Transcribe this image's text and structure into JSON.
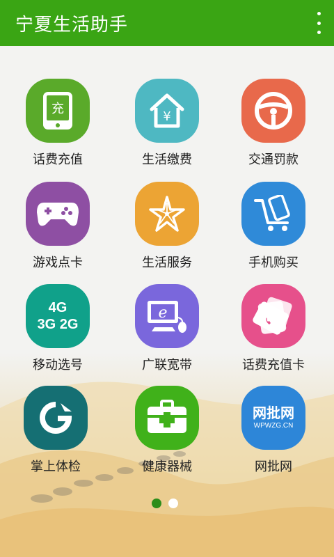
{
  "app_bar": {
    "title": "宁夏生活助手",
    "menu_icon": "overflow-menu-icon"
  },
  "tiles": [
    {
      "label": "话费充值",
      "icon": "phone-recharge-icon",
      "glyph": "充",
      "color": "#5aaa2a"
    },
    {
      "label": "生活缴费",
      "icon": "house-yen-icon",
      "glyph": "¥",
      "color": "#4eb8c2"
    },
    {
      "label": "交通罚款",
      "icon": "steering-wheel-icon",
      "color": "#e8694b"
    },
    {
      "label": "游戏点卡",
      "icon": "gamepad-icon",
      "color": "#8e4fa3"
    },
    {
      "label": "生活服务",
      "icon": "flower-service-icon",
      "color": "#eca434"
    },
    {
      "label": "手机购买",
      "icon": "phone-cart-icon",
      "color": "#2f8ad8"
    },
    {
      "label": "移动选号",
      "icon": "network-4g-3g-2g-icon",
      "glyph_top": "4G",
      "glyph_bottom": "3G 2G",
      "color": "#10a18a"
    },
    {
      "label": "广联宽带",
      "icon": "computer-broadband-icon",
      "glyph": "e",
      "color": "#7a67dc"
    },
    {
      "label": "话费充值卡",
      "icon": "recharge-card-icon",
      "color": "#e6508b"
    },
    {
      "label": "掌上体检",
      "icon": "health-check-logo-icon",
      "color": "#156f73"
    },
    {
      "label": "健康器械",
      "icon": "medical-kit-icon",
      "color": "#40b11a"
    },
    {
      "label": "网批网",
      "icon": "wpwzg-logo-icon",
      "glyph_top": "网批网",
      "glyph_bottom": "WPWZG.CN",
      "color": "#2d86d8"
    }
  ],
  "pager": {
    "pages": 2,
    "current": 1
  }
}
